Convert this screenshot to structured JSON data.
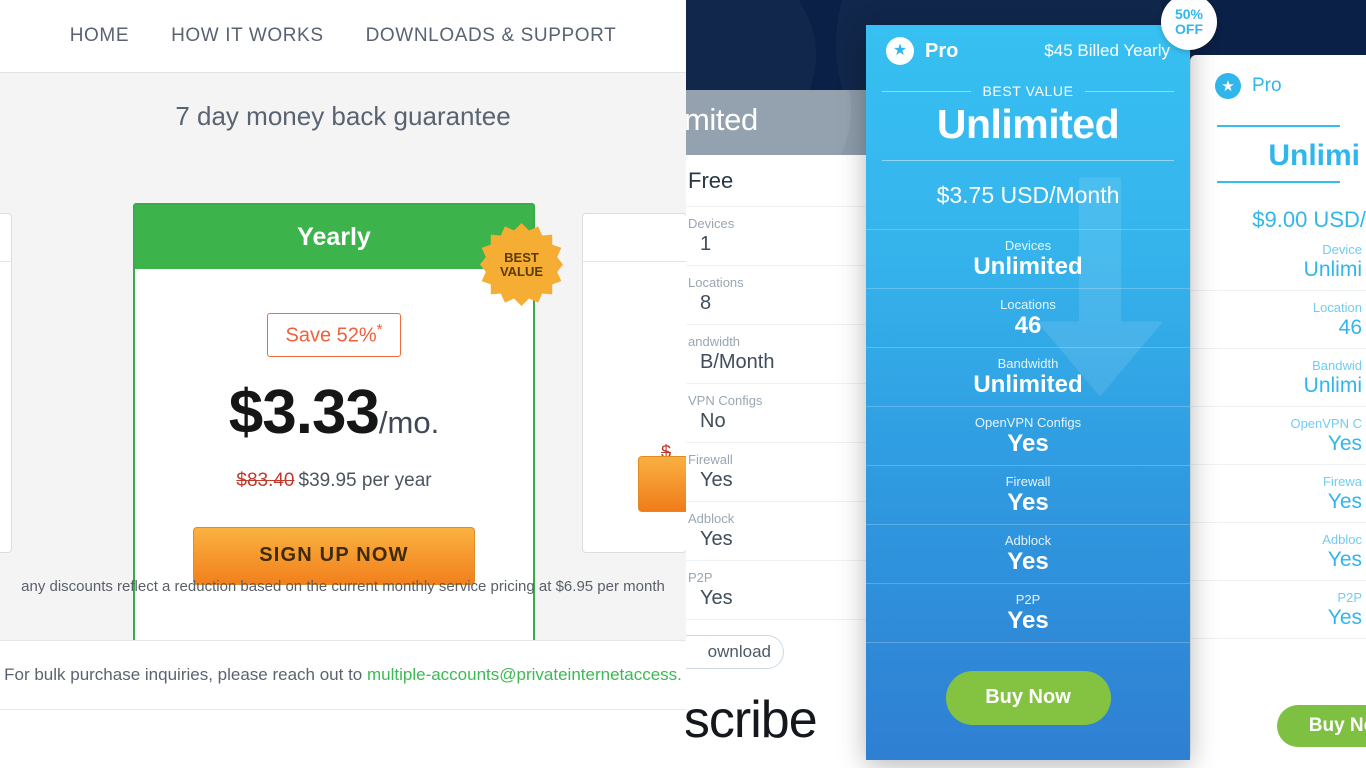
{
  "pia": {
    "nav": [
      {
        "label": "HOME"
      },
      {
        "label": "HOW IT WORKS"
      },
      {
        "label": "DOWNLOADS & SUPPORT"
      }
    ],
    "guarantee": "7 day money back guarantee",
    "yearly": {
      "title": "Yearly",
      "save_label": "Save 52%",
      "save_asterisk": "*",
      "price_main": "$3.33",
      "price_suffix": "/mo.",
      "old_price": "$83.40",
      "new_price": "$39.95 per year",
      "cta": "SIGN UP NOW",
      "badge_line1": "BEST",
      "badge_line2": "VALUE"
    },
    "side_right_strike": "$",
    "footnote": "any discounts reflect a reduction based on the current monthly service pricing at $6.95 per month",
    "bulk_text": "For bulk purchase inquiries, please reach out to ",
    "bulk_email": "multiple-accounts@privateinternetaccess."
  },
  "windscribe": {
    "hero_title": "mited",
    "subscribe_text": "dscribe",
    "free_plan": {
      "name": "Free",
      "rows": [
        {
          "label": "Devices",
          "value": "1"
        },
        {
          "label": "Locations",
          "value": "8"
        },
        {
          "label": "andwidth",
          "value": "B/Month"
        },
        {
          "label": "VPN Configs",
          "value": "No"
        },
        {
          "label": "Firewall",
          "value": "Yes"
        },
        {
          "label": "Adblock",
          "value": "Yes"
        },
        {
          "label": "P2P",
          "value": "Yes"
        }
      ],
      "download_label": "ownload"
    },
    "pro_card": {
      "plan_name": "Pro",
      "star_icon": "★",
      "billed": "$45 Billed Yearly",
      "best_value": "BEST VALUE",
      "headline": "Unlimited",
      "price": "$3.75 USD/Month",
      "rows": [
        {
          "label": "Devices",
          "value": "Unlimited"
        },
        {
          "label": "Locations",
          "value": "46"
        },
        {
          "label": "Bandwidth",
          "value": "Unlimited"
        },
        {
          "label": "OpenVPN Configs",
          "value": "Yes"
        },
        {
          "label": "Firewall",
          "value": "Yes"
        },
        {
          "label": "Adblock",
          "value": "Yes"
        },
        {
          "label": "P2P",
          "value": "Yes"
        }
      ],
      "cta": "Buy Now",
      "off_badge_line1": "50%",
      "off_badge_line2": "OFF"
    },
    "pro_light": {
      "plan_name": "Pro",
      "star_icon": "★",
      "headline": "Unlimi",
      "price": "$9.00 USD/",
      "rows": [
        {
          "label": "Device",
          "value": "Unlimi"
        },
        {
          "label": "Location",
          "value": "46"
        },
        {
          "label": "Bandwid",
          "value": "Unlimi"
        },
        {
          "label": "OpenVPN C",
          "value": "Yes"
        },
        {
          "label": "Firewa",
          "value": "Yes"
        },
        {
          "label": "Adbloc",
          "value": "Yes"
        },
        {
          "label": "P2P",
          "value": "Yes"
        }
      ],
      "cta": "Buy No"
    }
  },
  "colors": {
    "pia_green": "#3cb34b",
    "pia_orange": "#f2801c",
    "ws_blue": "#31b6ec",
    "ws_green": "#84c341",
    "ws_navy": "#0a2046"
  }
}
